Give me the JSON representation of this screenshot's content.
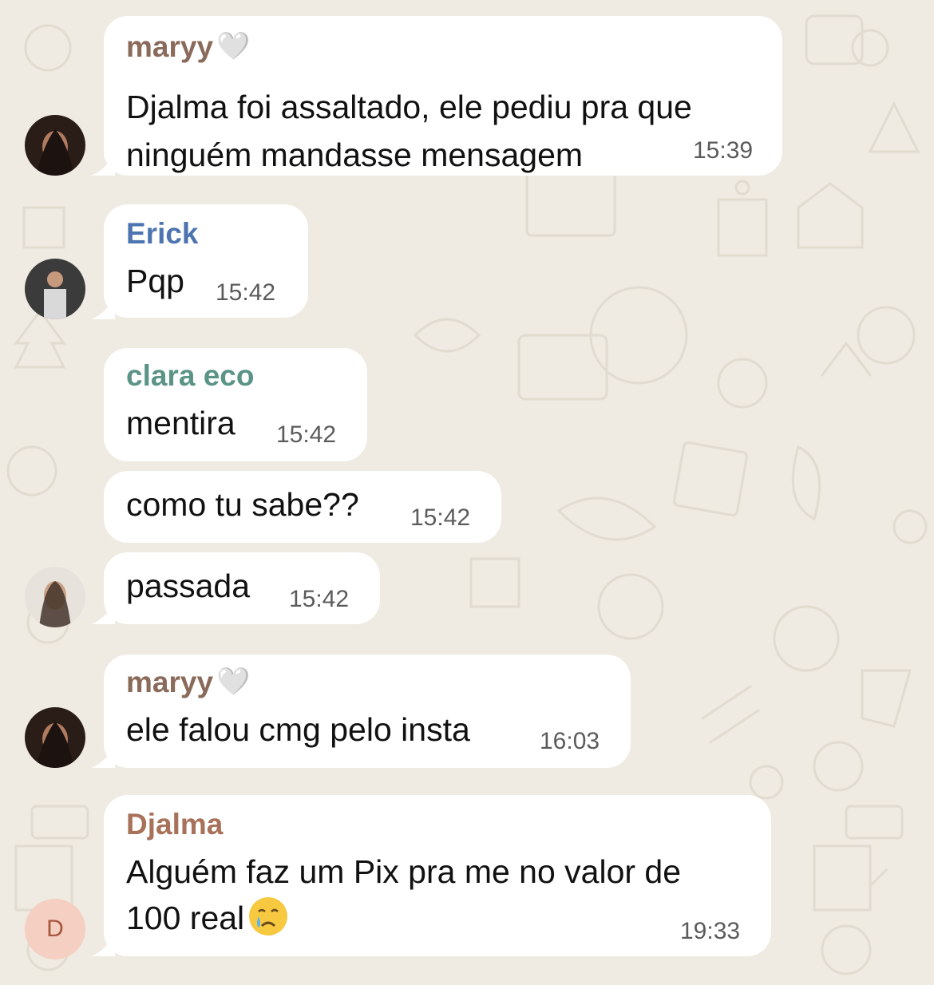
{
  "colors": {
    "background": "#efeae2",
    "bubble": "#ffffff",
    "maryy": "#8a6a5a",
    "erick": "#4d74b0",
    "clara": "#5b9487",
    "djalma": "#a8715a",
    "time": "#5b5b5b"
  },
  "messages": [
    {
      "sender": "maryy",
      "sender_suffix": "🤍",
      "lines": [
        "Djalma foi assaltado, ele pediu pra que",
        "ninguém mandasse mensagem"
      ],
      "time": "15:39"
    },
    {
      "sender": "Erick",
      "lines": [
        "Pqp"
      ],
      "time": "15:42"
    },
    {
      "sender": "clara eco",
      "lines": [
        "mentira"
      ],
      "time": "15:42"
    },
    {
      "sender": "",
      "lines": [
        "como tu sabe??"
      ],
      "time": "15:42"
    },
    {
      "sender": "",
      "lines": [
        "passada"
      ],
      "time": "15:42"
    },
    {
      "sender": "maryy",
      "sender_suffix": "🤍",
      "lines": [
        "ele falou cmg pelo insta"
      ],
      "time": "16:03"
    },
    {
      "sender": "Djalma",
      "lines": [
        "Alguém faz um Pix pra me no valor de",
        "100 real"
      ],
      "emoji": "crying-face-icon",
      "time": "19:33"
    }
  ],
  "avatars": {
    "djalma_initial": "D"
  }
}
